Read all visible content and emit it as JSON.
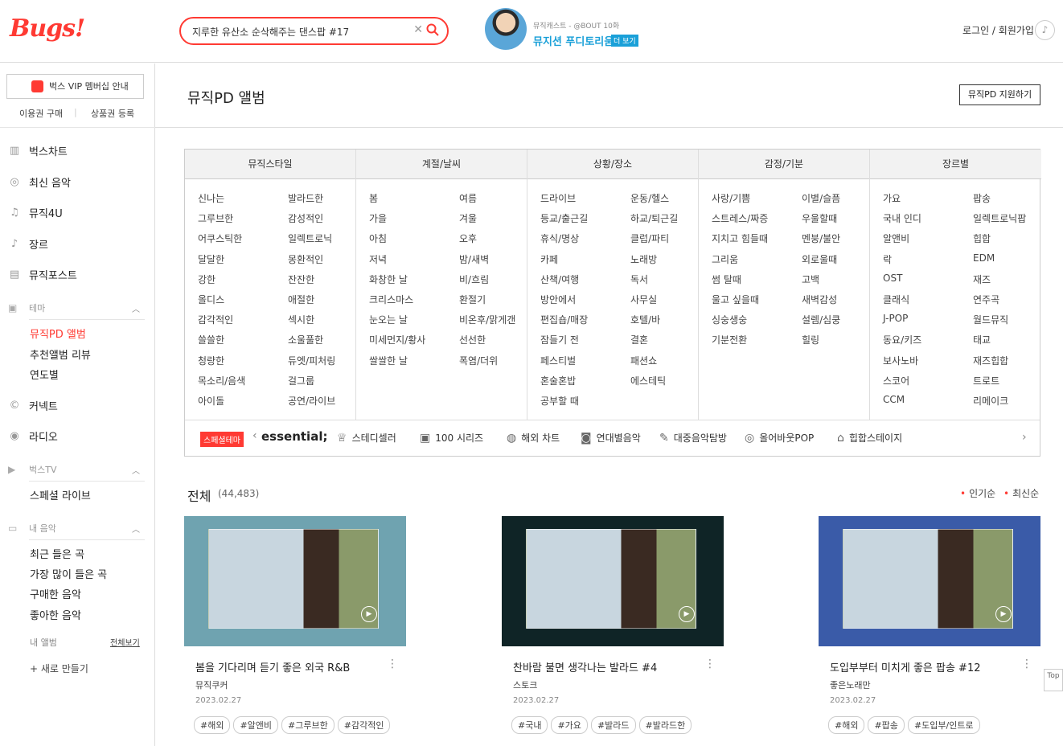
{
  "header": {
    "logo": "Bugs!",
    "search_value": "지루한 유산소 순삭해주는 댄스팝 #17",
    "clear_icon": "✕",
    "promo_sub": "뮤직캐스트 - @BOUT 10화",
    "promo_title": "뮤지션 푸디토리움",
    "promo_more": "더 보기",
    "login": "로그인 / 회원가입"
  },
  "sidebar": {
    "vip": "벅스 VIP 멤버십 안내",
    "buy": "이용권 구매",
    "sep": "|",
    "coupon": "상품권 등록",
    "nav": [
      "벅스차트",
      "최신 음악",
      "뮤직4U",
      "장르",
      "뮤직포스트"
    ],
    "theme": "테마",
    "theme_items": [
      "뮤직PD 앨범",
      "추천앨범 리뷰",
      "연도별"
    ],
    "nav2": [
      "커넥트",
      "라디오"
    ],
    "bugstv": "벅스TV",
    "tv_items": [
      "스페셜 라이브"
    ],
    "mymusic": "내 음악",
    "my_items": [
      "최근 들은 곡",
      "가장 많이 들은 곡",
      "구매한 음악",
      "좋아한 음악"
    ],
    "my_album": "내 앨범",
    "view_all": "전체보기",
    "new_album": "+ 새로 만들기"
  },
  "main": {
    "title": "뮤직PD 앨범",
    "apply": "뮤직PD 지원하기",
    "categories": [
      {
        "head": "뮤직스타일",
        "items": [
          "신나는",
          "발라드한",
          "그루브한",
          "감성적인",
          "어쿠스틱한",
          "일렉트로닉",
          "달달한",
          "몽환적인",
          "강한",
          "잔잔한",
          "올디스",
          "애절한",
          "감각적인",
          "섹시한",
          "쓸쓸한",
          "소울풀한",
          "청량한",
          "듀엣/피처링",
          "목소리/음색",
          "걸그룹",
          "아이돌",
          "공연/라이브"
        ]
      },
      {
        "head": "계절/날씨",
        "items": [
          "봄",
          "여름",
          "가을",
          "겨울",
          "아침",
          "오후",
          "저녁",
          "밤/새벽",
          "화창한 날",
          "비/흐림",
          "크리스마스",
          "환절기",
          "눈오는 날",
          "비온후/맑게갠",
          "미세먼지/황사",
          "선선한",
          "쌀쌀한 날",
          "폭염/더위"
        ]
      },
      {
        "head": "상황/장소",
        "items": [
          "드라이브",
          "운동/헬스",
          "등교/출근길",
          "하교/퇴근길",
          "휴식/명상",
          "클럽/파티",
          "카페",
          "노래방",
          "산책/여행",
          "독서",
          "방안에서",
          "사무실",
          "편집숍/매장",
          "호텔/바",
          "잠들기 전",
          "결혼",
          "페스티벌",
          "패션쇼",
          "혼술혼밥",
          "에스테틱",
          "공부할 때"
        ]
      },
      {
        "head": "감정/기분",
        "items": [
          "사랑/기쁨",
          "이별/슬픔",
          "스트레스/짜증",
          "우울할때",
          "지치고 힘들때",
          "멘붕/불안",
          "그리움",
          "외로울때",
          "썸 탈때",
          "고백",
          "울고 싶을때",
          "새벽감성",
          "싱숭생숭",
          "설렘/심쿵",
          "기분전환",
          "힐링"
        ]
      },
      {
        "head": "장르별",
        "items": [
          "가요",
          "팝송",
          "국내 인디",
          "일렉트로닉팝",
          "알앤비",
          "힙합",
          "락",
          "EDM",
          "OST",
          "재즈",
          "클래식",
          "연주곡",
          "J-POP",
          "월드뮤직",
          "동요/키즈",
          "태교",
          "보사노바",
          "재즈힙합",
          "스코어",
          "트로트",
          "CCM",
          "리메이크"
        ]
      }
    ],
    "special_badge": "스페셜테마",
    "prev_icon": "‹",
    "next_icon": "›",
    "essential": "essential;",
    "essential_items": [
      "스테디셀러",
      "100 시리즈",
      "해외 차트",
      "연대별음악",
      "대중음악탐방",
      "올어바웃POP",
      "힙합스테이지"
    ],
    "all_title": "전체",
    "all_count": "(44,483)",
    "sort_popular": "인기순",
    "sort_recent": "최신순",
    "sort_dot": "•",
    "cards": [
      {
        "title": "봄을 기다리며 듣기 좋은 외국 R&B",
        "curator": "뮤직쿠커",
        "date": "2023.02.27",
        "tags": [
          "#해외",
          "#알앤비",
          "#그루브한",
          "#감각적인"
        ],
        "bg": "#6fa3b0"
      },
      {
        "title": "찬바람 불면 생각나는 발라드 #4",
        "curator": "스토크",
        "date": "2023.02.27",
        "tags": [
          "#국내",
          "#가요",
          "#발라드",
          "#발라드한"
        ],
        "bg": "#0f2426"
      },
      {
        "title": "도입부부터 미치게 좋은 팝송 #12",
        "curator": "좋은노래만",
        "date": "2023.02.27",
        "tags": [
          "#해외",
          "#팝송",
          "#도입부/인트로"
        ],
        "bg": "#3a5ba8"
      }
    ],
    "play_icon": "▶",
    "more_icon": "⋮"
  },
  "top": "Top"
}
